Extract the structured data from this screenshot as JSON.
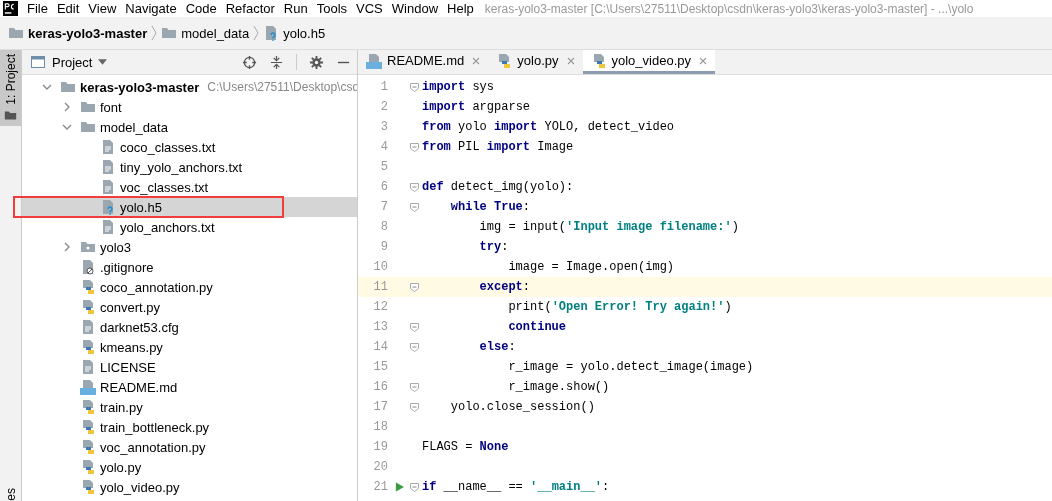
{
  "menu_bar": {
    "items": [
      "File",
      "Edit",
      "View",
      "Navigate",
      "Code",
      "Refactor",
      "Run",
      "Tools",
      "VCS",
      "Window",
      "Help"
    ],
    "title": "keras-yolo3-master [C:\\Users\\27511\\Desktop\\csdn\\keras-yolo3\\keras-yolo3-master] - ...\\yolo"
  },
  "breadcrumbs": [
    {
      "label": "keras-yolo3-master",
      "kind": "folder",
      "bold": true
    },
    {
      "label": "model_data",
      "kind": "folder",
      "bold": false
    },
    {
      "label": "yolo.h5",
      "kind": "unknown",
      "bold": false
    }
  ],
  "left_stripe": {
    "tabs": [
      {
        "label": "1: Project",
        "selected": true
      }
    ],
    "bottom_label": "es"
  },
  "project_panel": {
    "title": "Project",
    "tree": [
      {
        "label": "keras-yolo3-master",
        "hint": "C:\\Users\\27511\\Desktop\\csd",
        "kind": "folder",
        "expanded": true,
        "selected": false,
        "children": [
          {
            "label": "font",
            "kind": "folder",
            "expanded": false,
            "selected": false
          },
          {
            "label": "model_data",
            "kind": "folder",
            "expanded": true,
            "selected": false,
            "children": [
              {
                "label": "coco_classes.txt",
                "kind": "text",
                "selected": false
              },
              {
                "label": "tiny_yolo_anchors.txt",
                "kind": "text",
                "selected": false
              },
              {
                "label": "voc_classes.txt",
                "kind": "text",
                "selected": false
              },
              {
                "label": "yolo.h5",
                "kind": "unknown",
                "selected": true
              },
              {
                "label": "yolo_anchors.txt",
                "kind": "text",
                "selected": false
              }
            ]
          },
          {
            "label": "yolo3",
            "kind": "package",
            "expanded": false,
            "selected": false
          },
          {
            "label": ".gitignore",
            "kind": "ignore",
            "selected": false
          },
          {
            "label": "coco_annotation.py",
            "kind": "python",
            "selected": false
          },
          {
            "label": "convert.py",
            "kind": "python",
            "selected": false
          },
          {
            "label": "darknet53.cfg",
            "kind": "text",
            "selected": false
          },
          {
            "label": "kmeans.py",
            "kind": "python",
            "selected": false
          },
          {
            "label": "LICENSE",
            "kind": "text",
            "selected": false
          },
          {
            "label": "README.md",
            "kind": "markdown",
            "selected": false
          },
          {
            "label": "train.py",
            "kind": "python",
            "selected": false
          },
          {
            "label": "train_bottleneck.py",
            "kind": "python",
            "selected": false
          },
          {
            "label": "voc_annotation.py",
            "kind": "python",
            "selected": false
          },
          {
            "label": "yolo.py",
            "kind": "python",
            "selected": false
          },
          {
            "label": "yolo_video.py",
            "kind": "python",
            "selected": false
          }
        ]
      }
    ]
  },
  "editor": {
    "tabs": [
      {
        "label": "README.md",
        "kind": "markdown",
        "selected": false
      },
      {
        "label": "yolo.py",
        "kind": "python",
        "selected": false
      },
      {
        "label": "yolo_video.py",
        "kind": "python",
        "selected": true
      }
    ],
    "lines": [
      {
        "number": "1",
        "fold": true,
        "current": false,
        "run": false,
        "tokens": [
          {
            "text": "import",
            "kind": "keyword"
          },
          {
            "text": " sys",
            "kind": "plain"
          }
        ]
      },
      {
        "number": "2",
        "fold": false,
        "current": false,
        "run": false,
        "tokens": [
          {
            "text": "import",
            "kind": "keyword"
          },
          {
            "text": " argparse",
            "kind": "plain"
          }
        ]
      },
      {
        "number": "3",
        "fold": false,
        "current": false,
        "run": false,
        "tokens": [
          {
            "text": "from",
            "kind": "keyword"
          },
          {
            "text": " yolo ",
            "kind": "plain"
          },
          {
            "text": "import",
            "kind": "keyword"
          },
          {
            "text": " YOLO, detect_video",
            "kind": "plain"
          }
        ]
      },
      {
        "number": "4",
        "fold": true,
        "current": false,
        "run": false,
        "tokens": [
          {
            "text": "from",
            "kind": "keyword"
          },
          {
            "text": " PIL ",
            "kind": "plain"
          },
          {
            "text": "import",
            "kind": "keyword"
          },
          {
            "text": " Image",
            "kind": "plain"
          }
        ]
      },
      {
        "number": "5",
        "fold": false,
        "current": false,
        "run": false
      },
      {
        "number": "6",
        "fold": true,
        "current": false,
        "run": false,
        "tokens": [
          {
            "text": "def",
            "kind": "keyword"
          },
          {
            "text": " detect_img(yolo):",
            "kind": "plain"
          }
        ]
      },
      {
        "number": "7",
        "fold": true,
        "current": false,
        "run": false,
        "tokens": [
          {
            "text": "    while",
            "kind": "keyword"
          },
          {
            "text": " True",
            "kind": "keyword"
          },
          {
            "text": ":",
            "kind": "plain"
          }
        ]
      },
      {
        "number": "8",
        "fold": false,
        "current": false,
        "run": false,
        "tokens": [
          {
            "text": "        img = input(",
            "kind": "plain"
          },
          {
            "text": "'Input image filename:'",
            "kind": "string"
          },
          {
            "text": ")",
            "kind": "plain"
          }
        ]
      },
      {
        "number": "9",
        "fold": false,
        "current": false,
        "run": false,
        "tokens": [
          {
            "text": "        try",
            "kind": "keyword"
          },
          {
            "text": ":",
            "kind": "plain"
          }
        ]
      },
      {
        "number": "10",
        "fold": false,
        "current": false,
        "run": false,
        "tokens": [
          {
            "text": "            image = Image.open(img)",
            "kind": "plain"
          }
        ]
      },
      {
        "number": "11",
        "fold": true,
        "current": true,
        "run": false,
        "tokens": [
          {
            "text": "        except",
            "kind": "keyword"
          },
          {
            "text": ":",
            "kind": "plain"
          }
        ]
      },
      {
        "number": "12",
        "fold": false,
        "current": false,
        "run": false,
        "tokens": [
          {
            "text": "            print(",
            "kind": "plain"
          },
          {
            "text": "'Open Error! Try again!'",
            "kind": "string"
          },
          {
            "text": ")",
            "kind": "plain"
          }
        ]
      },
      {
        "number": "13",
        "fold": true,
        "current": false,
        "run": false,
        "tokens": [
          {
            "text": "            continue",
            "kind": "keyword"
          }
        ]
      },
      {
        "number": "14",
        "fold": true,
        "current": false,
        "run": false,
        "tokens": [
          {
            "text": "        else",
            "kind": "keyword"
          },
          {
            "text": ":",
            "kind": "plain"
          }
        ]
      },
      {
        "number": "15",
        "fold": false,
        "current": false,
        "run": false,
        "tokens": [
          {
            "text": "            r_image = yolo.detect_image(image)",
            "kind": "plain"
          }
        ]
      },
      {
        "number": "16",
        "fold": true,
        "current": false,
        "run": false,
        "tokens": [
          {
            "text": "            r_image.show()",
            "kind": "plain"
          }
        ]
      },
      {
        "number": "17",
        "fold": true,
        "current": false,
        "run": false,
        "tokens": [
          {
            "text": "    yolo.close_session()",
            "kind": "plain"
          }
        ]
      },
      {
        "number": "18",
        "fold": false,
        "current": false,
        "run": false
      },
      {
        "number": "19",
        "fold": false,
        "current": false,
        "run": false,
        "tokens": [
          {
            "text": "FLAGS = ",
            "kind": "plain"
          },
          {
            "text": "None",
            "kind": "keyword"
          }
        ]
      },
      {
        "number": "20",
        "fold": false,
        "current": false,
        "run": false
      },
      {
        "number": "21",
        "fold": true,
        "current": false,
        "run": true,
        "tokens": [
          {
            "text": "if",
            "kind": "keyword"
          },
          {
            "text": " __name__ == ",
            "kind": "plain"
          },
          {
            "text": "'__main__'",
            "kind": "string"
          },
          {
            "text": ":",
            "kind": "plain"
          }
        ]
      }
    ]
  }
}
